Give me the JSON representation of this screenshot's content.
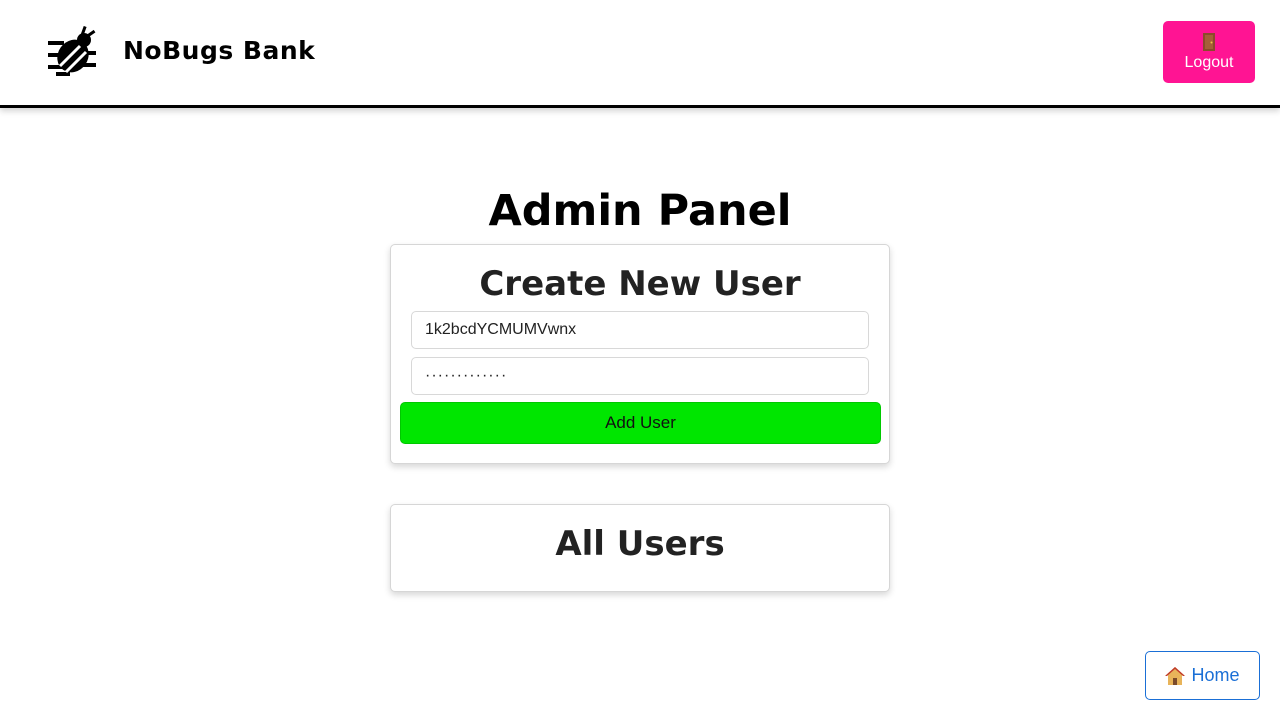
{
  "header": {
    "brand": "NoBugs Bank",
    "logout_label": "Logout",
    "logout_color": "#ff1493"
  },
  "main": {
    "page_title": "Admin Panel"
  },
  "create_user": {
    "title": "Create New User",
    "username_value": "1k2bcdYCMUMVwnx",
    "password_value": "·············",
    "add_button_label": "Add User",
    "add_button_color": "#00e600"
  },
  "all_users": {
    "title": "All Users"
  },
  "footer": {
    "home_label": "Home"
  },
  "icons": {
    "logo": "bug-icon",
    "logout": "door-icon",
    "home": "house-icon"
  }
}
